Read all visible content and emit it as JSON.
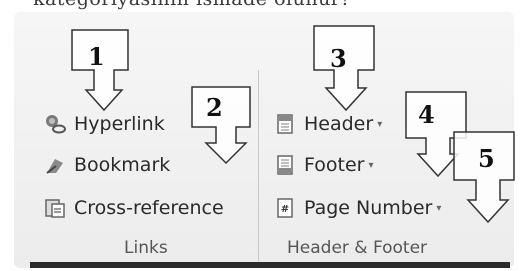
{
  "top_text": "kategoriyasinin ismade olunur?",
  "links_group": {
    "items": [
      {
        "label": "Hyperlink",
        "icon": "hyperlink-icon"
      },
      {
        "label": "Bookmark",
        "icon": "bookmark-icon"
      },
      {
        "label": "Cross-reference",
        "icon": "cross-reference-icon"
      }
    ],
    "group_label": "Links"
  },
  "header_footer_group": {
    "items": [
      {
        "label": "Header",
        "icon": "header-icon"
      },
      {
        "label": "Footer",
        "icon": "footer-icon"
      },
      {
        "label": "Page Number",
        "icon": "page-number-icon"
      }
    ],
    "group_label": "Header & Footer"
  },
  "callouts": [
    "1",
    "2",
    "3",
    "4",
    "5"
  ],
  "colors": {
    "ribbon_bg": "#efefef",
    "text": "#2a2a2a",
    "separator": "#c9c9c9"
  }
}
